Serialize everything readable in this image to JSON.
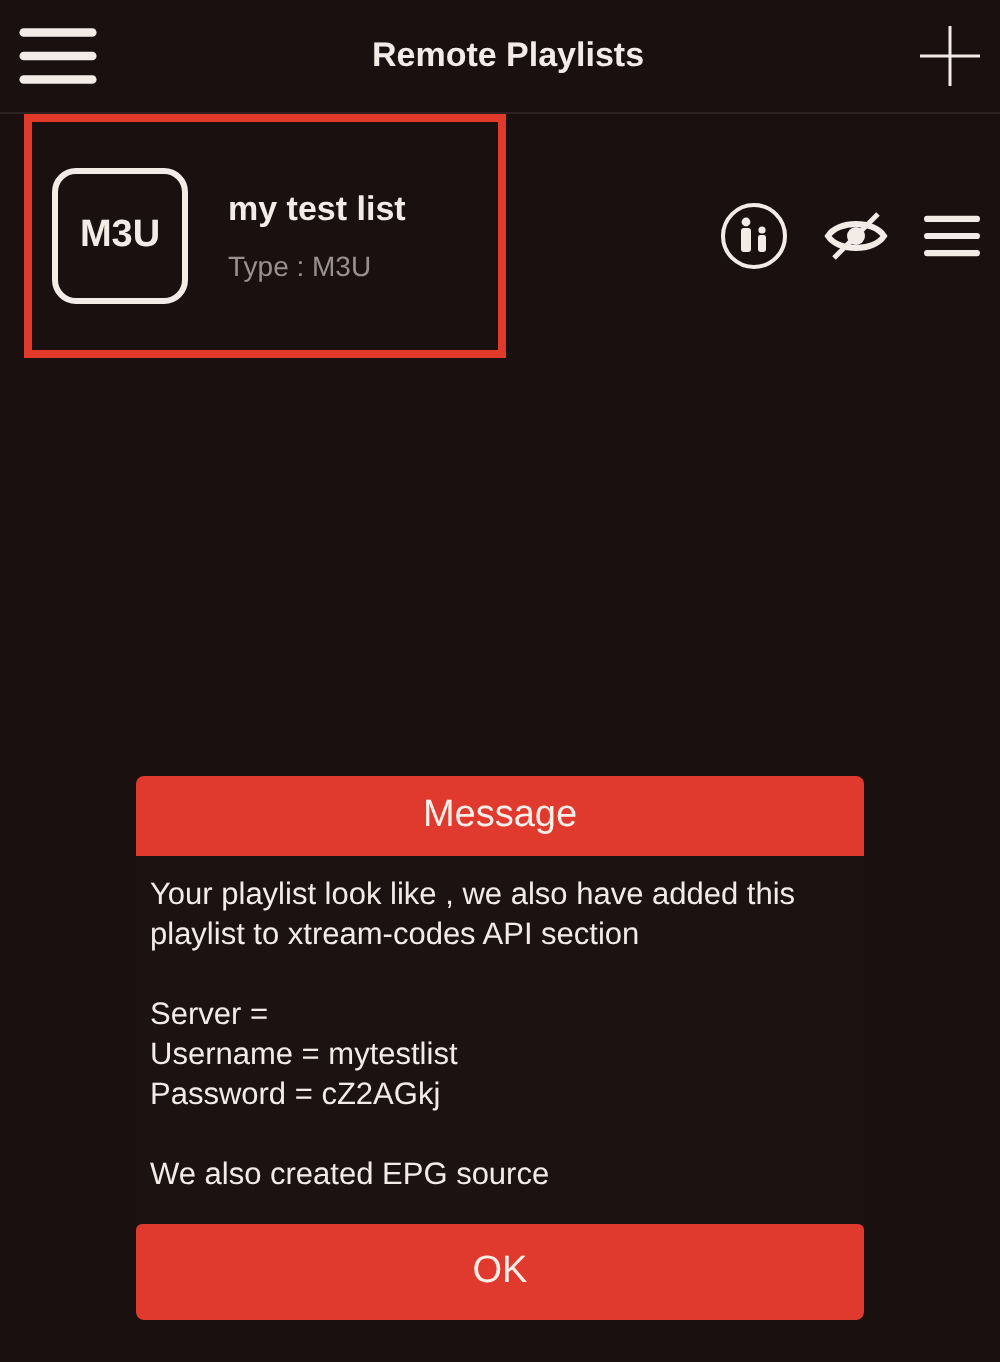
{
  "header": {
    "title": "Remote Playlists"
  },
  "playlists": [
    {
      "badge": "M3U",
      "name": "my test list",
      "type": "Type : M3U",
      "highlighted": true
    }
  ],
  "dialog": {
    "title": "Message",
    "paragraphs": [
      [
        "Your playlist look like , we also have added this playlist to xtream-codes API section"
      ],
      [
        "Server =",
        "Username = mytestlist",
        "Password = cZ2AGkj"
      ],
      [
        "We also created EPG source"
      ]
    ],
    "button": "OK"
  }
}
